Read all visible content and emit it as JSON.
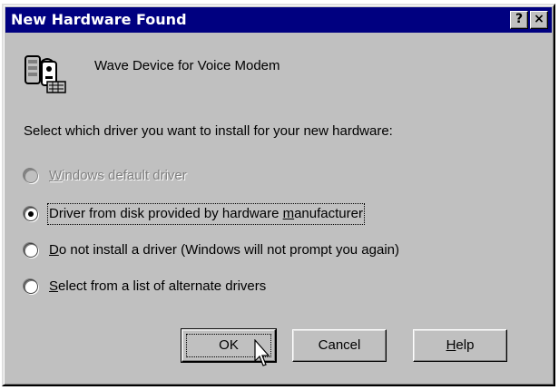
{
  "dialog": {
    "title": "New Hardware Found",
    "help_button": "?",
    "close_button": "×"
  },
  "device": {
    "name": "Wave Device for Voice Modem",
    "icon": "modem-device-icon"
  },
  "prompt": "Select which driver you want to install for your new hardware:",
  "options": [
    {
      "pre": "",
      "accel": "W",
      "post": "indows default driver",
      "selected": false,
      "enabled": false
    },
    {
      "pre": "Driver from disk provided by hardware ",
      "accel": "m",
      "post": "anufacturer",
      "selected": true,
      "enabled": true
    },
    {
      "pre": "",
      "accel": "D",
      "post": "o not install a driver (Windows will not prompt you again)",
      "selected": false,
      "enabled": true
    },
    {
      "pre": "",
      "accel": "S",
      "post": "elect from a list of alternate drivers",
      "selected": false,
      "enabled": true
    }
  ],
  "buttons": {
    "ok": "OK",
    "cancel": "Cancel",
    "help_pre": "",
    "help_accel": "H",
    "help_post": "elp"
  },
  "colors": {
    "titlebar": "#000080",
    "face": "#c0c0c0",
    "disabled_text": "#808080"
  }
}
